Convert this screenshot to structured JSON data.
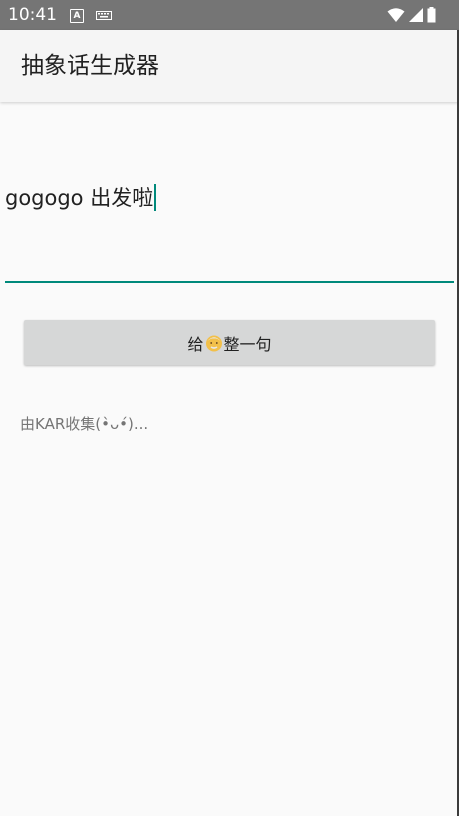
{
  "status_bar": {
    "time": "10:41",
    "a_icon_letter": "A",
    "icons": [
      "a-icon",
      "keyboard-icon",
      "wifi-icon",
      "signal-icon",
      "battery-icon"
    ]
  },
  "app_bar": {
    "title": "抽象话生成器"
  },
  "input": {
    "value": "gogogo 出发啦"
  },
  "button": {
    "label_before": "给",
    "label_after": "整一句",
    "icon": "old-man-face-icon"
  },
  "credit": {
    "text": "由KAR收集(•̀ᴗ•́)..."
  },
  "colors": {
    "accent": "#00897b",
    "status_bar": "#757575",
    "button": "#d6d7d7"
  }
}
